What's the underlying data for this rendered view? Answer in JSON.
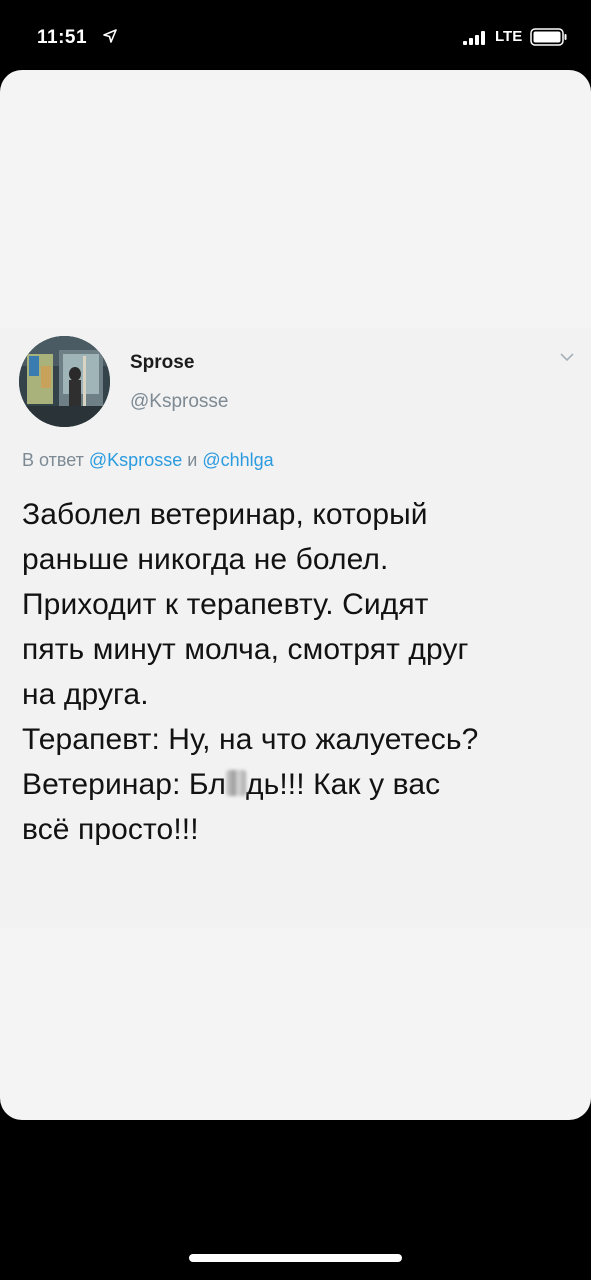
{
  "status_bar": {
    "time": "11:51",
    "network": "LTE"
  },
  "tweet": {
    "display_name": "Sprose",
    "handle": "@Ksprosse",
    "reply_prefix": "В ответ",
    "reply_mention_1": "@Ksprosse",
    "reply_and": "и",
    "reply_mention_2": "@chhlga",
    "text_lines": [
      "Заболел ветеринар, который",
      "раньше никогда не болел.",
      "Приходит к терапевту. Сидят",
      "пять минут молча, смотрят друг",
      "на друга.",
      "Терапевт: Ну, на что жалуетесь?"
    ],
    "line7_before": "Ветеринар: Бл",
    "line7_after": "дь!!! Как у вас",
    "line8": "всё просто!!!"
  },
  "colors": {
    "mention": "#2b9be0",
    "secondary_text": "#7d8a94",
    "card_background": "#f4f4f4"
  }
}
